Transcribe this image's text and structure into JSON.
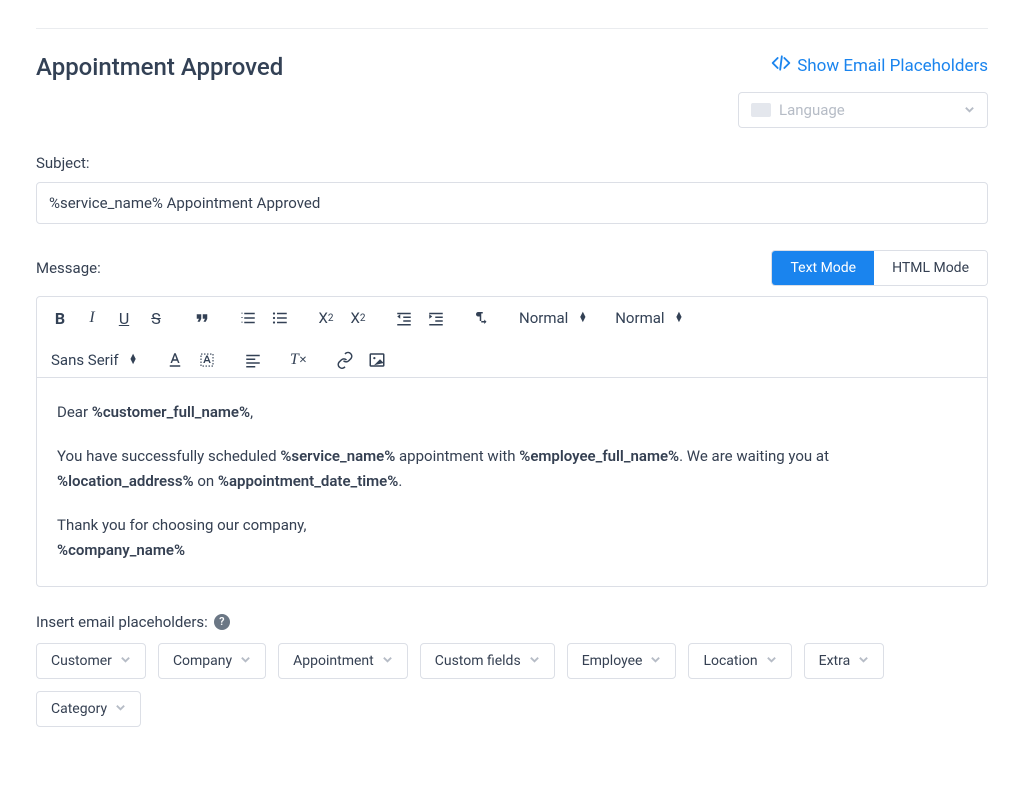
{
  "header": {
    "title": "Appointment Approved",
    "show_placeholders_label": "Show Email Placeholders",
    "language_placeholder": "Language"
  },
  "subject": {
    "label": "Subject:",
    "value": "%service_name% Appointment Approved"
  },
  "message": {
    "label": "Message:",
    "text_mode": "Text Mode",
    "html_mode": "HTML Mode"
  },
  "toolbar": {
    "header_sel": "Normal",
    "size_sel": "Normal",
    "font_sel": "Sans Serif"
  },
  "body": {
    "greeting_prefix": "Dear ",
    "greeting_ph": "%customer_full_name%",
    "greeting_suffix": ",",
    "line2_a": "You have successfully scheduled ",
    "line2_ph1": "%service_name%",
    "line2_b": " appointment with ",
    "line2_ph2": "%employee_full_name%",
    "line2_c": ". We are waiting you at ",
    "line2_ph3": "%location_address%",
    "line2_d": " on ",
    "line2_ph4": "%appointment_date_time%",
    "line2_e": ".",
    "thanks": "Thank you for choosing our company,",
    "company_ph": "%company_name%"
  },
  "placeholders": {
    "label": "Insert email placeholders:",
    "buttons": [
      "Customer",
      "Company",
      "Appointment",
      "Custom fields",
      "Employee",
      "Location",
      "Extra",
      "Category"
    ]
  }
}
